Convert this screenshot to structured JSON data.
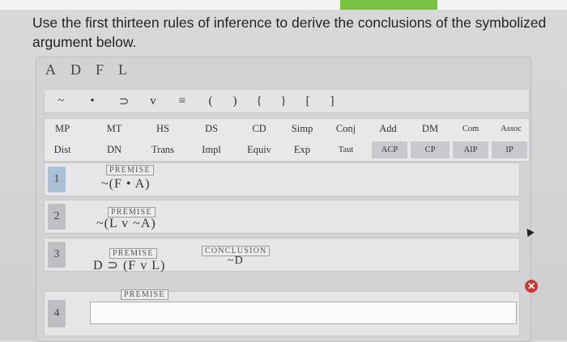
{
  "question": "Use the first thirteen rules of inference to derive the conclusions of the symbolized argument below.",
  "variables": [
    "A",
    "D",
    "F",
    "L"
  ],
  "symbols": [
    "~",
    "•",
    "⊃",
    "v",
    "≡",
    "(",
    ")",
    "{",
    "}",
    "[",
    "]"
  ],
  "rules_row1": [
    "MP",
    "MT",
    "HS",
    "DS",
    "CD",
    "Simp",
    "Conj",
    "Add",
    "DM",
    "Com",
    "Assoc"
  ],
  "rules_row2": [
    "Dist",
    "DN",
    "Trans",
    "Impl",
    "Equiv",
    "Exp",
    "Taut",
    "ACP",
    "CP",
    "AIP",
    "IP"
  ],
  "lines": [
    {
      "num": "1",
      "tag": "PREMISE",
      "formula": "~(F • A)"
    },
    {
      "num": "2",
      "tag": "PREMISE",
      "formula": "~(L v ~A)"
    },
    {
      "num": "3",
      "tag": "PREMISE",
      "formula": "D ⊃ (F v L)",
      "conclusion_tag": "CONCLUSION",
      "conclusion": "~D"
    },
    {
      "num": "4",
      "tag": "PREMISE",
      "formula": ""
    }
  ],
  "delete_icon": "x-circle-icon",
  "accent": "#c93a3a"
}
